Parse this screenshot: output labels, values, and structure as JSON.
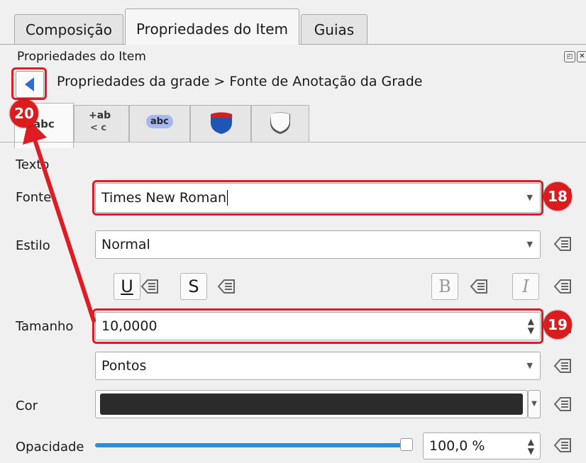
{
  "tabs": [
    "Composição",
    "Propriedades do Item",
    "Guias"
  ],
  "panel_title": "Propriedades do Item",
  "breadcrumb": "Propriedades da grade > Fonte de Anotação da Grade",
  "subtabs": {
    "tab1_label": "abc",
    "tab2_top": "+ab",
    "tab2_bottom": "< c",
    "tab3_label": "abc"
  },
  "section_heading": "Texto",
  "form": {
    "font_label": "Fonte",
    "font_value": "Times New Roman",
    "style_label": "Estilo",
    "style_value": "Normal",
    "underline": "U",
    "strikeout": "S",
    "bold": "B",
    "italic": "I",
    "size_label": "Tamanho",
    "size_value": "10,0000",
    "units_value": "Pontos",
    "color_label": "Cor",
    "color_value": "#2b2b2b",
    "opacity_label": "Opacidade",
    "opacity_value": "100,0 %",
    "opacity_level": 1.0
  },
  "annotations": {
    "badge_font": "18",
    "badge_size": "19",
    "badge_back": "20",
    "color": "#e01b24"
  }
}
